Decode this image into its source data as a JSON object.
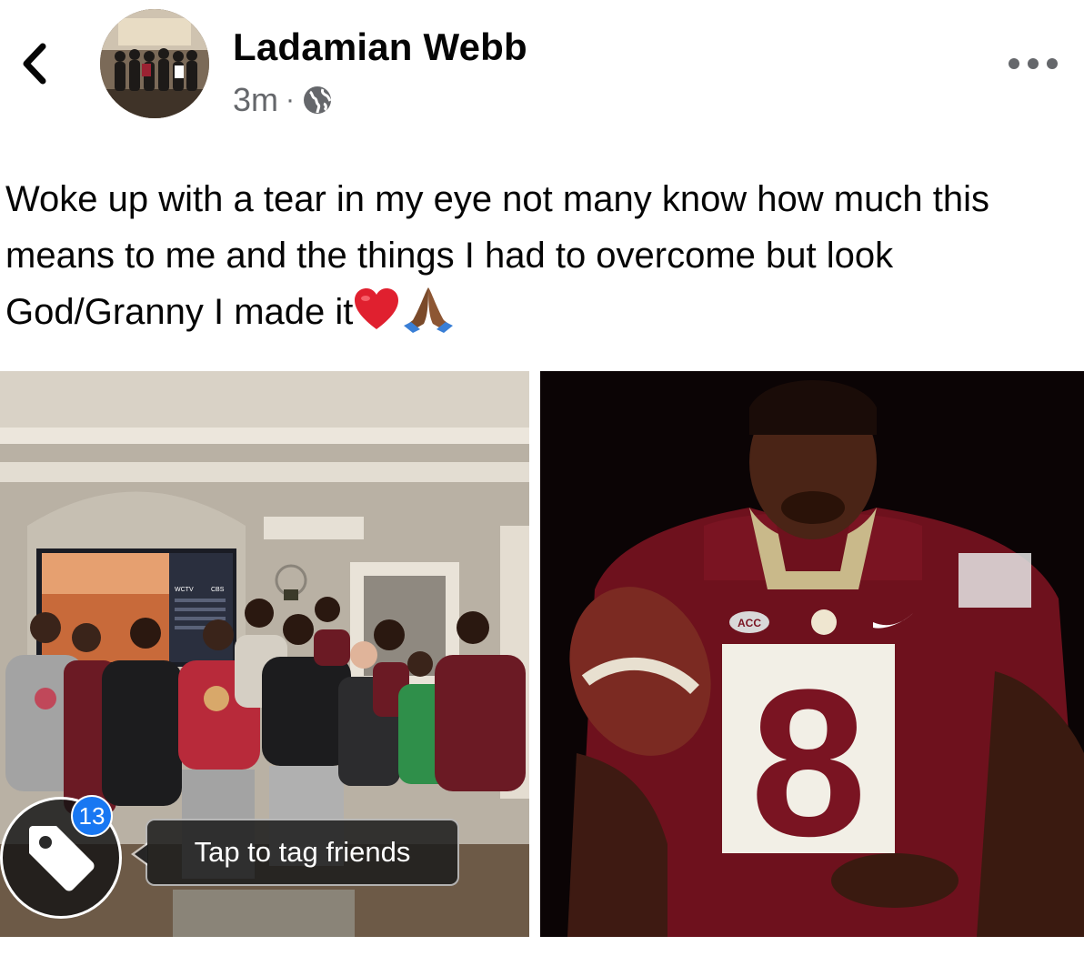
{
  "header": {
    "back_icon": "chevron-left-icon",
    "author_name": "Ladamian Webb",
    "timestamp": "3m",
    "separator": "·",
    "privacy_icon": "globe-icon",
    "more_icon": "ellipsis-icon"
  },
  "post": {
    "text": "Woke up with a tear in my eye not many know how much this means to me and the things I had to overcome but look God/Granny I made it",
    "emojis": [
      "heart-emoji",
      "folded-hands-emoji"
    ]
  },
  "photos": {
    "left": {
      "tv_label": "WCTV",
      "tv_label_2": "CBS",
      "name": "group-photo"
    },
    "right": {
      "jersey_number": "8",
      "patch_text": "ACC",
      "name": "player-portrait-photo"
    }
  },
  "tagging": {
    "count": "13",
    "prompt": "Tap to tag friends",
    "icon": "tag-icon"
  },
  "colors": {
    "accent": "#1877f2",
    "secondary_text": "#65676b",
    "jersey": "#7a1422"
  }
}
